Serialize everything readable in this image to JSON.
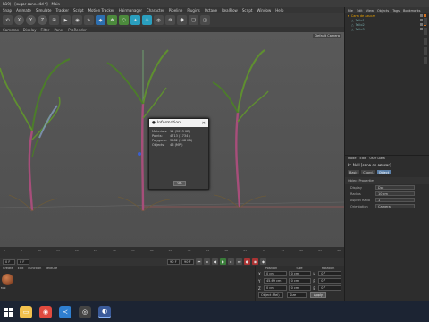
{
  "window": {
    "title": "R19) - [sugar cane.c4d *] - Main"
  },
  "menubar": {
    "items": [
      "Snap",
      "Animate",
      "Simulate",
      "Tracker",
      "Script",
      "Motion Tracker",
      "Hairmanager",
      "Character",
      "Pipeline",
      "Plugins",
      "Octane",
      "RealFlow",
      "Script",
      "Window",
      "Help"
    ]
  },
  "toolbar": {
    "buttons": [
      "X",
      "Y",
      "Z",
      "⟲",
      "⊞",
      "▶",
      "◉",
      "✎",
      "◆",
      "❖",
      "⬡",
      "✦",
      "☀",
      "◍",
      "⚙",
      "⬢",
      "❏",
      "◫"
    ]
  },
  "viewport": {
    "menu": [
      "Cameras",
      "Display",
      "Filter",
      "Panel",
      "ProRender"
    ],
    "camera_label": "Default Camera"
  },
  "info_dialog": {
    "title": "Information",
    "rows": [
      {
        "k": "Materials:",
        "v": "11 (3013 KB)"
      },
      {
        "k": "Points:",
        "v": "4713 (1734 )"
      },
      {
        "k": "Polygons:",
        "v": "3582 (148 KB)"
      },
      {
        "k": "Objects:",
        "v": "46 (MP )"
      }
    ],
    "ok_label": "OK"
  },
  "timeline": {
    "ticks": [
      "0",
      "5",
      "10",
      "15",
      "20",
      "25",
      "30",
      "35",
      "40",
      "45",
      "50",
      "55",
      "60",
      "65",
      "70",
      "75",
      "80",
      "85",
      "90"
    ]
  },
  "playback": {
    "current_frame": "0 F",
    "end_frame": "90 F",
    "start_frame": "0 F",
    "max_frame": "90 F"
  },
  "materials": {
    "menu": [
      "Create",
      "Edit",
      "Function",
      "Texture"
    ],
    "mat_name": "Mat"
  },
  "coordinates": {
    "headers": [
      "Position",
      "Size",
      "Rotation"
    ],
    "rows": [
      {
        "axis": "X",
        "pos": "0 cm",
        "size": "0 cm",
        "rot_label": "H",
        "rot": "0 °"
      },
      {
        "axis": "Y",
        "pos": "45.69 cm",
        "size": "0 cm",
        "rot_label": "P",
        "rot": "0 °"
      },
      {
        "axis": "Z",
        "pos": "0 cm",
        "size": "0 cm",
        "rot_label": "B",
        "rot": "0 °"
      }
    ],
    "mode": "Object (Rel)",
    "size_mode": "Size",
    "apply_label": "Apply"
  },
  "object_manager": {
    "menu": [
      "File",
      "Edit",
      "View",
      "Objects",
      "Tags",
      "Bookmarks"
    ],
    "items": [
      {
        "name": "Cana de azucar",
        "sub": false
      },
      {
        "name": "Tallo1",
        "sub": true
      },
      {
        "name": "Tallo2",
        "sub": true
      },
      {
        "name": "Tallo3",
        "sub": true
      }
    ]
  },
  "attribute_manager": {
    "menu": [
      "Mode",
      "Edit",
      "User Data"
    ],
    "title": "Null [cana de azucar]",
    "tabs": [
      "Basic",
      "Coord.",
      "Object"
    ],
    "active_tab": "Object",
    "section": "Object Properties",
    "rows": [
      {
        "k": "Display",
        "v": "Dot"
      },
      {
        "k": "Radius",
        "v": "10 cm"
      },
      {
        "k": "Aspect Ratio",
        "v": "1"
      },
      {
        "k": "Orientation",
        "v": "Camera"
      }
    ]
  },
  "taskbar": {
    "apps": [
      {
        "name": "start-button"
      },
      {
        "name": "file-explorer",
        "glyph": "▭",
        "color": "#f2c14e"
      },
      {
        "name": "chrome",
        "glyph": "◉",
        "color": "#e04a3f"
      },
      {
        "name": "visual-studio-code",
        "glyph": "≺",
        "color": "#2f7fd1"
      },
      {
        "name": "obs",
        "glyph": "◎",
        "color": "#444"
      },
      {
        "name": "cinema4d",
        "glyph": "◐",
        "color": "#3b5b9a"
      }
    ]
  }
}
